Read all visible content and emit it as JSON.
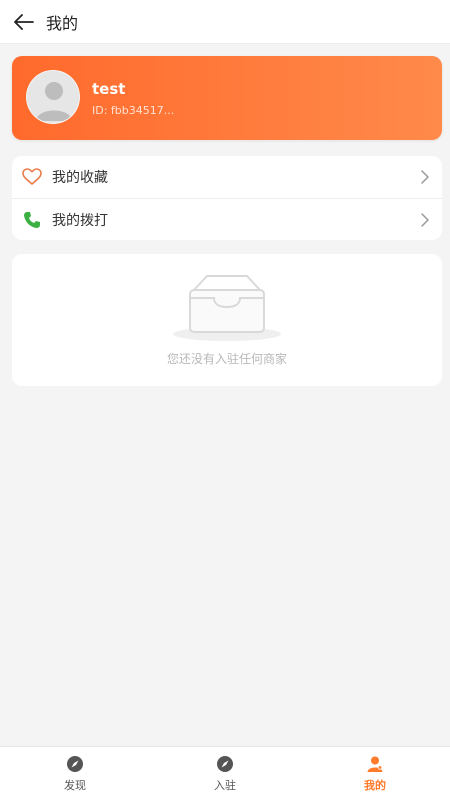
{
  "header": {
    "title": "我的",
    "back_icon": "back-arrow-icon"
  },
  "profile": {
    "name": "test",
    "id_text": "ID: fbb34517..."
  },
  "menu": [
    {
      "label": "我的收藏",
      "icon": "heart-icon"
    },
    {
      "label": "我的拨打",
      "icon": "phone-icon"
    }
  ],
  "empty": {
    "message": "您还没有入驻任何商家",
    "icon": "empty-inbox-icon"
  },
  "tabs": [
    {
      "label": "发现",
      "icon": "compass-icon",
      "active": false
    },
    {
      "label": "入驻",
      "icon": "compass-icon",
      "active": false
    },
    {
      "label": "我的",
      "icon": "person-icon",
      "active": true
    }
  ],
  "colors": {
    "accent": "#ff7a2a",
    "heart": "#e97a48",
    "phone": "#3cb043"
  }
}
